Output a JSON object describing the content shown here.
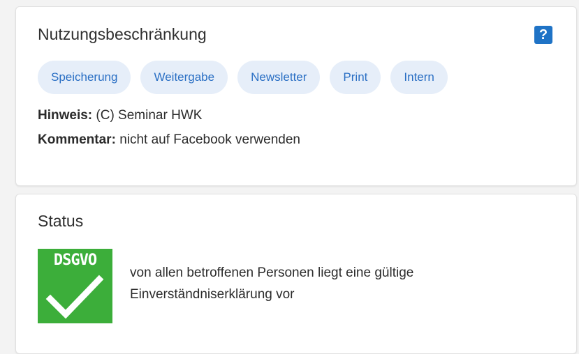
{
  "usage_card": {
    "title": "Nutzungsbeschränkung",
    "help_label": "?",
    "chips": [
      "Speicherung",
      "Weitergabe",
      "Newsletter",
      "Print",
      "Intern"
    ],
    "hinweis_label": "Hinweis:",
    "hinweis_value": "(C) Seminar HWK",
    "kommentar_label": "Kommentar:",
    "kommentar_value": "nicht auf Facebook verwenden"
  },
  "status_card": {
    "title": "Status",
    "badge_text": "DSGVO",
    "badge_color": "#3cae3a",
    "status_line_1": "von allen betroffenen Personen liegt eine gültige",
    "status_line_2": "Einverständniserklärung vor"
  },
  "colors": {
    "accent": "#1f73c6",
    "chip_bg": "#e6eef9",
    "chip_text": "#2a6fc4"
  }
}
